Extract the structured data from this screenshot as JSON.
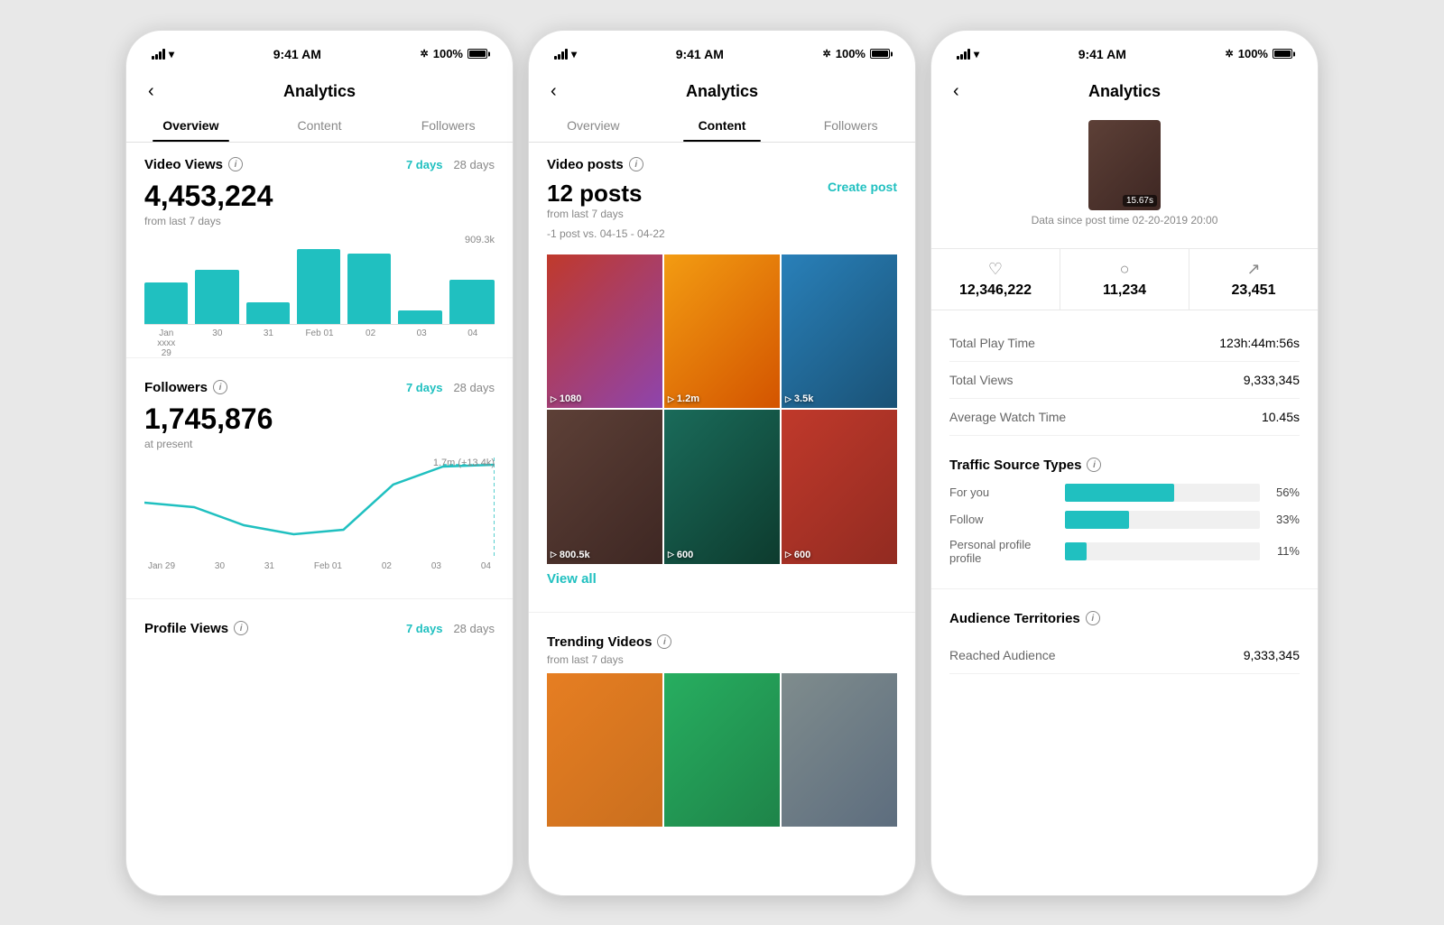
{
  "phones": [
    {
      "id": "phone1",
      "statusBar": {
        "time": "9:41 AM",
        "battery": "100%"
      },
      "header": {
        "title": "Analytics",
        "backLabel": "‹"
      },
      "tabs": [
        {
          "id": "overview",
          "label": "Overview",
          "active": true
        },
        {
          "id": "content",
          "label": "Content",
          "active": false
        },
        {
          "id": "followers",
          "label": "Followers",
          "active": false
        }
      ],
      "sections": {
        "videoViews": {
          "title": "Video Views",
          "period7": "7 days",
          "period28": "28 days",
          "bigNumber": "4,453,224",
          "subText": "from last 7 days",
          "maxLabel": "909.3k",
          "chartBars": [
            55,
            75,
            30,
            100,
            95,
            20,
            60
          ],
          "chartLabels": [
            "Jan\nxxxxx\n29",
            "30",
            "31",
            "Feb 01",
            "02",
            "03",
            "04"
          ]
        },
        "followers": {
          "title": "Followers",
          "period7": "7 days",
          "period28": "28 days",
          "bigNumber": "1,745,876",
          "subText": "at present",
          "maxLabel": "1.7m (+13.4k)",
          "lineLabels": [
            "Jan 29",
            "30",
            "31",
            "Feb 01",
            "02",
            "03",
            "04"
          ]
        },
        "profileViews": {
          "title": "Profile Views",
          "period7": "7 days",
          "period28": "28 days"
        }
      }
    },
    {
      "id": "phone2",
      "statusBar": {
        "time": "9:41 AM",
        "battery": "100%"
      },
      "header": {
        "title": "Analytics",
        "backLabel": "‹"
      },
      "tabs": [
        {
          "id": "overview",
          "label": "Overview",
          "active": false
        },
        {
          "id": "content",
          "label": "Content",
          "active": true
        },
        {
          "id": "followers",
          "label": "Followers",
          "active": false
        }
      ],
      "videoPosts": {
        "title": "Video posts",
        "count": "12 posts",
        "subText": "from last 7 days",
        "subText2": "-1 post vs. 04-15 - 04-22",
        "createPostLabel": "Create post",
        "viewAllLabel": "View all",
        "videos": [
          {
            "views": "1080",
            "color": "thumb-color-1"
          },
          {
            "views": "1.2m",
            "color": "thumb-color-2"
          },
          {
            "views": "3.5k",
            "color": "thumb-color-3"
          },
          {
            "views": "800.5k",
            "color": "thumb-color-4"
          },
          {
            "views": "600",
            "color": "thumb-color-5"
          },
          {
            "views": "600",
            "color": "thumb-color-6"
          }
        ]
      },
      "trendingVideos": {
        "title": "Trending Videos",
        "subText": "from last 7 days",
        "videos": [
          {
            "color": "thumb-color-7"
          },
          {
            "color": "thumb-color-8"
          },
          {
            "color": "thumb-color-9"
          }
        ]
      }
    },
    {
      "id": "phone3",
      "statusBar": {
        "time": "9:41 AM",
        "battery": "100%"
      },
      "header": {
        "title": "Analytics",
        "backLabel": "‹"
      },
      "postThumbnail": {
        "duration": "15.67s",
        "dataSince": "Data since post time 02-20-2019 20:00"
      },
      "stats": {
        "likes": "12,346,222",
        "comments": "11,234",
        "shares": "23,451"
      },
      "details": {
        "totalPlayTime": {
          "label": "Total Play Time",
          "value": "123h:44m:56s"
        },
        "totalViews": {
          "label": "Total Views",
          "value": "9,333,345"
        },
        "avgWatchTime": {
          "label": "Average Watch Time",
          "value": "10.45s"
        }
      },
      "trafficSources": {
        "title": "Traffic Source Types",
        "items": [
          {
            "label": "For you",
            "pct": 56,
            "pctLabel": "56%"
          },
          {
            "label": "Follow",
            "pct": 33,
            "pctLabel": "33%"
          },
          {
            "label": "Personal profile\nprofile",
            "pct": 11,
            "pctLabel": "11%"
          }
        ]
      },
      "audienceTerritories": {
        "title": "Audience Territories",
        "reachedAudience": {
          "label": "Reached Audience",
          "value": "9,333,345"
        }
      }
    }
  ]
}
